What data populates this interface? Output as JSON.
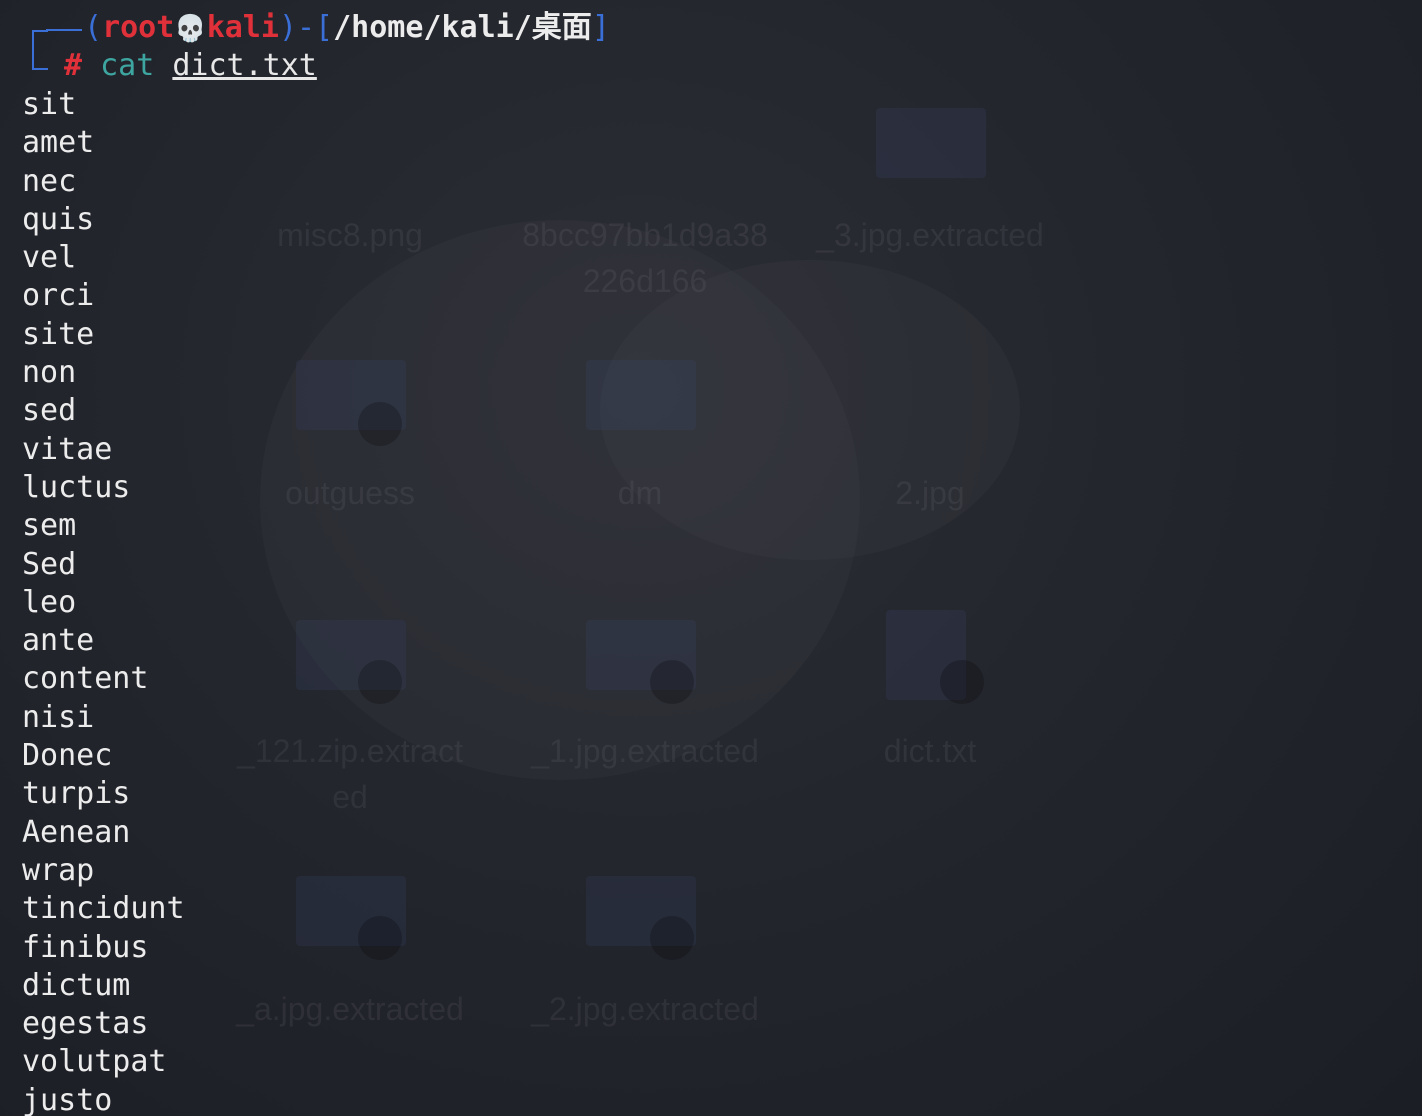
{
  "prompt": {
    "user": "root",
    "skull_icon": "skull-icon",
    "host": "kali",
    "path": "/home/kali/桌面",
    "symbol": "#",
    "command": "cat",
    "argument": "dict.txt"
  },
  "output_lines": [
    "sit",
    "amet",
    "nec",
    "quis",
    "vel",
    "orci",
    "site",
    "non",
    "sed",
    "vitae",
    "luctus",
    "sem",
    "Sed",
    "leo",
    "ante",
    "content",
    "nisi",
    "Donec",
    "turpis",
    "Aenean",
    "wrap",
    "tincidunt",
    "finibus",
    "dictum",
    "egestas",
    "volutpat",
    "justo"
  ],
  "desktop_icons": [
    {
      "label": "misc8.png"
    },
    {
      "label": "8bcc97bb1d9a38226d166"
    },
    {
      "label": "_3.jpg.extracted"
    },
    {
      "label": "outguess"
    },
    {
      "label": "dm"
    },
    {
      "label": "2.jpg"
    },
    {
      "label": "_121.zip.extracted"
    },
    {
      "label": "_1.jpg.extracted"
    },
    {
      "label": "dict.txt"
    },
    {
      "label": "_a.jpg.extracted"
    },
    {
      "label": "_2.jpg.extracted"
    }
  ],
  "colors": {
    "prompt_red": "#e0313a",
    "prompt_blue": "#3a6fd8",
    "command_teal": "#3ea6a0",
    "text": "#ececec",
    "background": "#23252d"
  }
}
